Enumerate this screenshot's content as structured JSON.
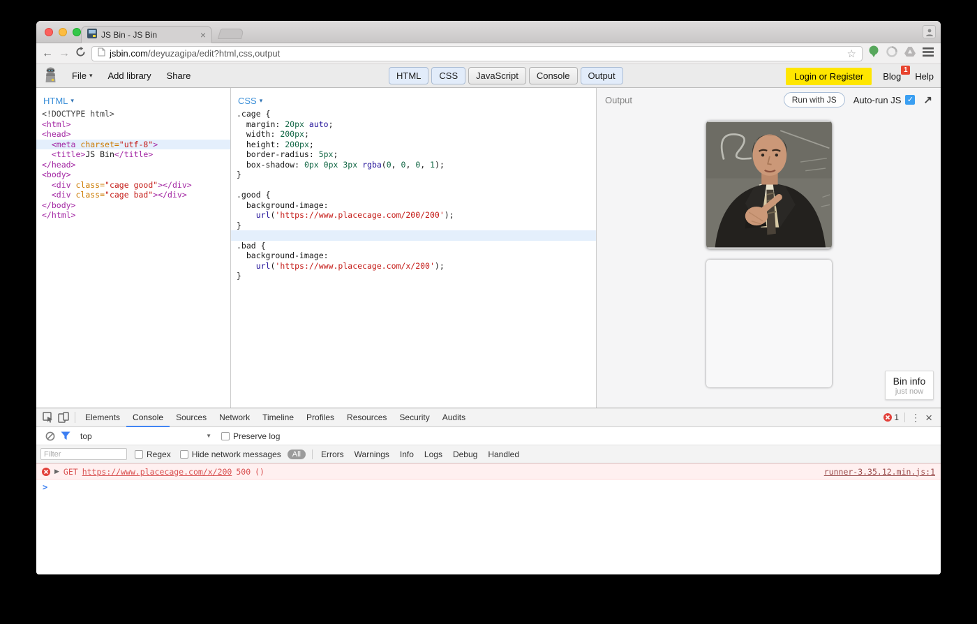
{
  "browser": {
    "tab_title": "JS Bin - JS Bin",
    "url": {
      "domain": "jsbin.com",
      "path": "/deyuzagipa/edit?html,css,output"
    }
  },
  "icons": {
    "back": "←",
    "forward": "→",
    "star": "☆",
    "popout": "↗",
    "caret_down": "▾",
    "dropdown_arrow": "▼",
    "disclosure": "▶",
    "overflow": "⋮",
    "close": "×",
    "tab_close": "×",
    "prompt": ">",
    "check": "✓"
  },
  "toolbar": {
    "file_label": "File",
    "add_library_label": "Add library",
    "share_label": "Share",
    "panel_buttons": [
      {
        "label": "HTML",
        "active": true
      },
      {
        "label": "CSS",
        "active": true
      },
      {
        "label": "JavaScript",
        "active": false
      },
      {
        "label": "Console",
        "active": false
      },
      {
        "label": "Output",
        "active": true
      }
    ],
    "login_label": "Login or Register",
    "blog_label": "Blog",
    "blog_badge": "1",
    "help_label": "Help"
  },
  "editors": {
    "html_label": "HTML",
    "css_label": "CSS",
    "html_lines": [
      {
        "tok": [
          [
            "m",
            "<!DOCTYPE html>"
          ]
        ]
      },
      {
        "tok": [
          [
            "t",
            "<html>"
          ]
        ]
      },
      {
        "tok": [
          [
            "t",
            "<head>"
          ]
        ]
      },
      {
        "hl": true,
        "tok": [
          [
            "p",
            "  "
          ],
          [
            "t",
            "<meta "
          ],
          [
            "a",
            "charset="
          ],
          [
            "s",
            "\"utf-8\""
          ],
          [
            "t",
            ">"
          ]
        ]
      },
      {
        "tok": [
          [
            "p",
            "  "
          ],
          [
            "t",
            "<title>"
          ],
          [
            "p",
            "JS Bin"
          ],
          [
            "t",
            "</title>"
          ]
        ]
      },
      {
        "tok": [
          [
            "t",
            "</head>"
          ]
        ]
      },
      {
        "tok": [
          [
            "t",
            "<body>"
          ]
        ]
      },
      {
        "tok": [
          [
            "p",
            "  "
          ],
          [
            "t",
            "<div "
          ],
          [
            "a",
            "class="
          ],
          [
            "s",
            "\"cage good\""
          ],
          [
            "t",
            "></div>"
          ]
        ]
      },
      {
        "tok": [
          [
            "p",
            "  "
          ],
          [
            "t",
            "<div "
          ],
          [
            "a",
            "class="
          ],
          [
            "s",
            "\"cage bad\""
          ],
          [
            "t",
            "></div>"
          ]
        ]
      },
      {
        "tok": [
          [
            "t",
            "</body>"
          ]
        ]
      },
      {
        "tok": [
          [
            "t",
            "</html>"
          ]
        ]
      }
    ],
    "css_lines": [
      {
        "tok": [
          [
            "p",
            ".cage {"
          ]
        ]
      },
      {
        "tok": [
          [
            "p",
            "  margin: "
          ],
          [
            "n",
            "20px"
          ],
          [
            "p",
            " "
          ],
          [
            "k",
            "auto"
          ],
          [
            "p",
            ";"
          ]
        ]
      },
      {
        "tok": [
          [
            "p",
            "  width: "
          ],
          [
            "n",
            "200px"
          ],
          [
            "p",
            ";"
          ]
        ]
      },
      {
        "tok": [
          [
            "p",
            "  height: "
          ],
          [
            "n",
            "200px"
          ],
          [
            "p",
            ";"
          ]
        ]
      },
      {
        "tok": [
          [
            "p",
            "  border-radius: "
          ],
          [
            "n",
            "5px"
          ],
          [
            "p",
            ";"
          ]
        ]
      },
      {
        "tok": [
          [
            "p",
            "  box-shadow: "
          ],
          [
            "n",
            "0px"
          ],
          [
            "p",
            " "
          ],
          [
            "n",
            "0px"
          ],
          [
            "p",
            " "
          ],
          [
            "n",
            "3px"
          ],
          [
            "p",
            " "
          ],
          [
            "k",
            "rgba"
          ],
          [
            "p",
            "("
          ],
          [
            "n",
            "0"
          ],
          [
            "p",
            ", "
          ],
          [
            "n",
            "0"
          ],
          [
            "p",
            ", "
          ],
          [
            "n",
            "0"
          ],
          [
            "p",
            ", "
          ],
          [
            "n",
            "1"
          ],
          [
            "p",
            ");"
          ]
        ]
      },
      {
        "tok": [
          [
            "p",
            "}"
          ]
        ]
      },
      {
        "tok": []
      },
      {
        "tok": [
          [
            "p",
            ".good {"
          ]
        ]
      },
      {
        "tok": [
          [
            "p",
            "  background-image:"
          ]
        ]
      },
      {
        "tok": [
          [
            "p",
            "    "
          ],
          [
            "k",
            "url"
          ],
          [
            "p",
            "("
          ],
          [
            "s",
            "'https://www.placecage.com/200/200'"
          ],
          [
            "p",
            ");"
          ]
        ]
      },
      {
        "tok": [
          [
            "p",
            "}"
          ]
        ]
      },
      {
        "hl": true,
        "tok": []
      },
      {
        "tok": [
          [
            "p",
            ".bad {"
          ]
        ]
      },
      {
        "tok": [
          [
            "p",
            "  background-image:"
          ]
        ]
      },
      {
        "tok": [
          [
            "p",
            "    "
          ],
          [
            "k",
            "url"
          ],
          [
            "p",
            "("
          ],
          [
            "s",
            "'https://www.placecage.com/x/200'"
          ],
          [
            "p",
            ");"
          ]
        ]
      },
      {
        "tok": [
          [
            "p",
            "}"
          ]
        ]
      }
    ]
  },
  "output": {
    "header_label": "Output",
    "run_button_label": "Run with JS",
    "autorun_label": "Auto-run JS",
    "autorun_checked": true,
    "bin_info": {
      "title": "Bin info",
      "time": "just now"
    }
  },
  "devtools": {
    "tabs": [
      "Elements",
      "Console",
      "Sources",
      "Network",
      "Timeline",
      "Profiles",
      "Resources",
      "Security",
      "Audits"
    ],
    "active_tab": "Console",
    "error_count": "1",
    "frame_selector": "top",
    "preserve_log_label": "Preserve log",
    "filter_placeholder": "Filter",
    "regex_label": "Regex",
    "hide_network_label": "Hide network messages",
    "level_all_label": "All",
    "level_labels": [
      "Errors",
      "Warnings",
      "Info",
      "Logs",
      "Debug",
      "Handled"
    ],
    "error": {
      "method": "GET",
      "url": "https://www.placecage.com/x/200",
      "status": "500",
      "parens": "()",
      "source": "runner-3.35.12.min.js:1"
    }
  },
  "colors": {
    "accent_yellow": "#ffe600",
    "active_panel_blue": "#e2ecfa",
    "checkbox_blue": "#3b9ff2",
    "error_red": "#d95050",
    "tab_underline_blue": "#4285f4"
  }
}
